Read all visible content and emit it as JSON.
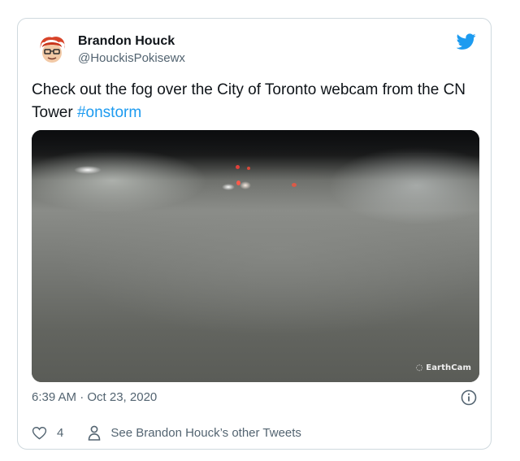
{
  "tweet": {
    "author_name": "Brandon Houck",
    "author_handle": "@HouckisPokisewx",
    "text": "Check out the fog over the City of Toronto webcam from the CN Tower ",
    "hashtag": "#onstorm",
    "timestamp": "6:39 AM · Oct 23, 2020",
    "like_count": "4",
    "see_other_label": "See Brandon Houck’s other Tweets"
  },
  "media": {
    "watermark": "EarthCam"
  },
  "icons": {
    "brand": "twitter-bird-icon",
    "avatar": "cartoon-avatar",
    "info": "info-icon",
    "like": "heart-icon",
    "profile": "person-icon"
  },
  "colors": {
    "accent": "#1d9bf0",
    "text": "#0f1419",
    "muted": "#536471",
    "border": "#cfd9de"
  }
}
